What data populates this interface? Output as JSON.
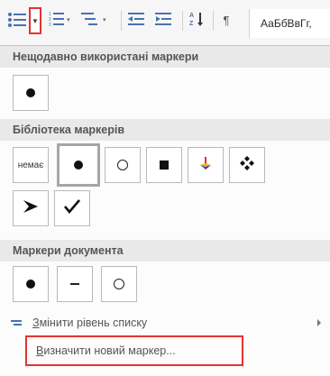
{
  "toolbar": {
    "icons": [
      "bullets-icon",
      "numbering-icon",
      "multilevel-list-icon",
      "decrease-indent-icon",
      "increase-indent-icon",
      "sort-icon",
      "pilcrow-icon"
    ],
    "style_preview_text": "АаБбВвГг,",
    "accent_color": "#e53333"
  },
  "sections": {
    "recent": {
      "title": "Нещодавно використані маркери"
    },
    "library": {
      "title": "Бібліотека маркерів",
      "none_label": "немає"
    },
    "document": {
      "title": "Маркери документа"
    }
  },
  "menu": {
    "change_level": {
      "first": "З",
      "rest": "мінити рівень списку"
    },
    "define_new": {
      "first": "В",
      "rest": "изначити новий маркер..."
    }
  }
}
